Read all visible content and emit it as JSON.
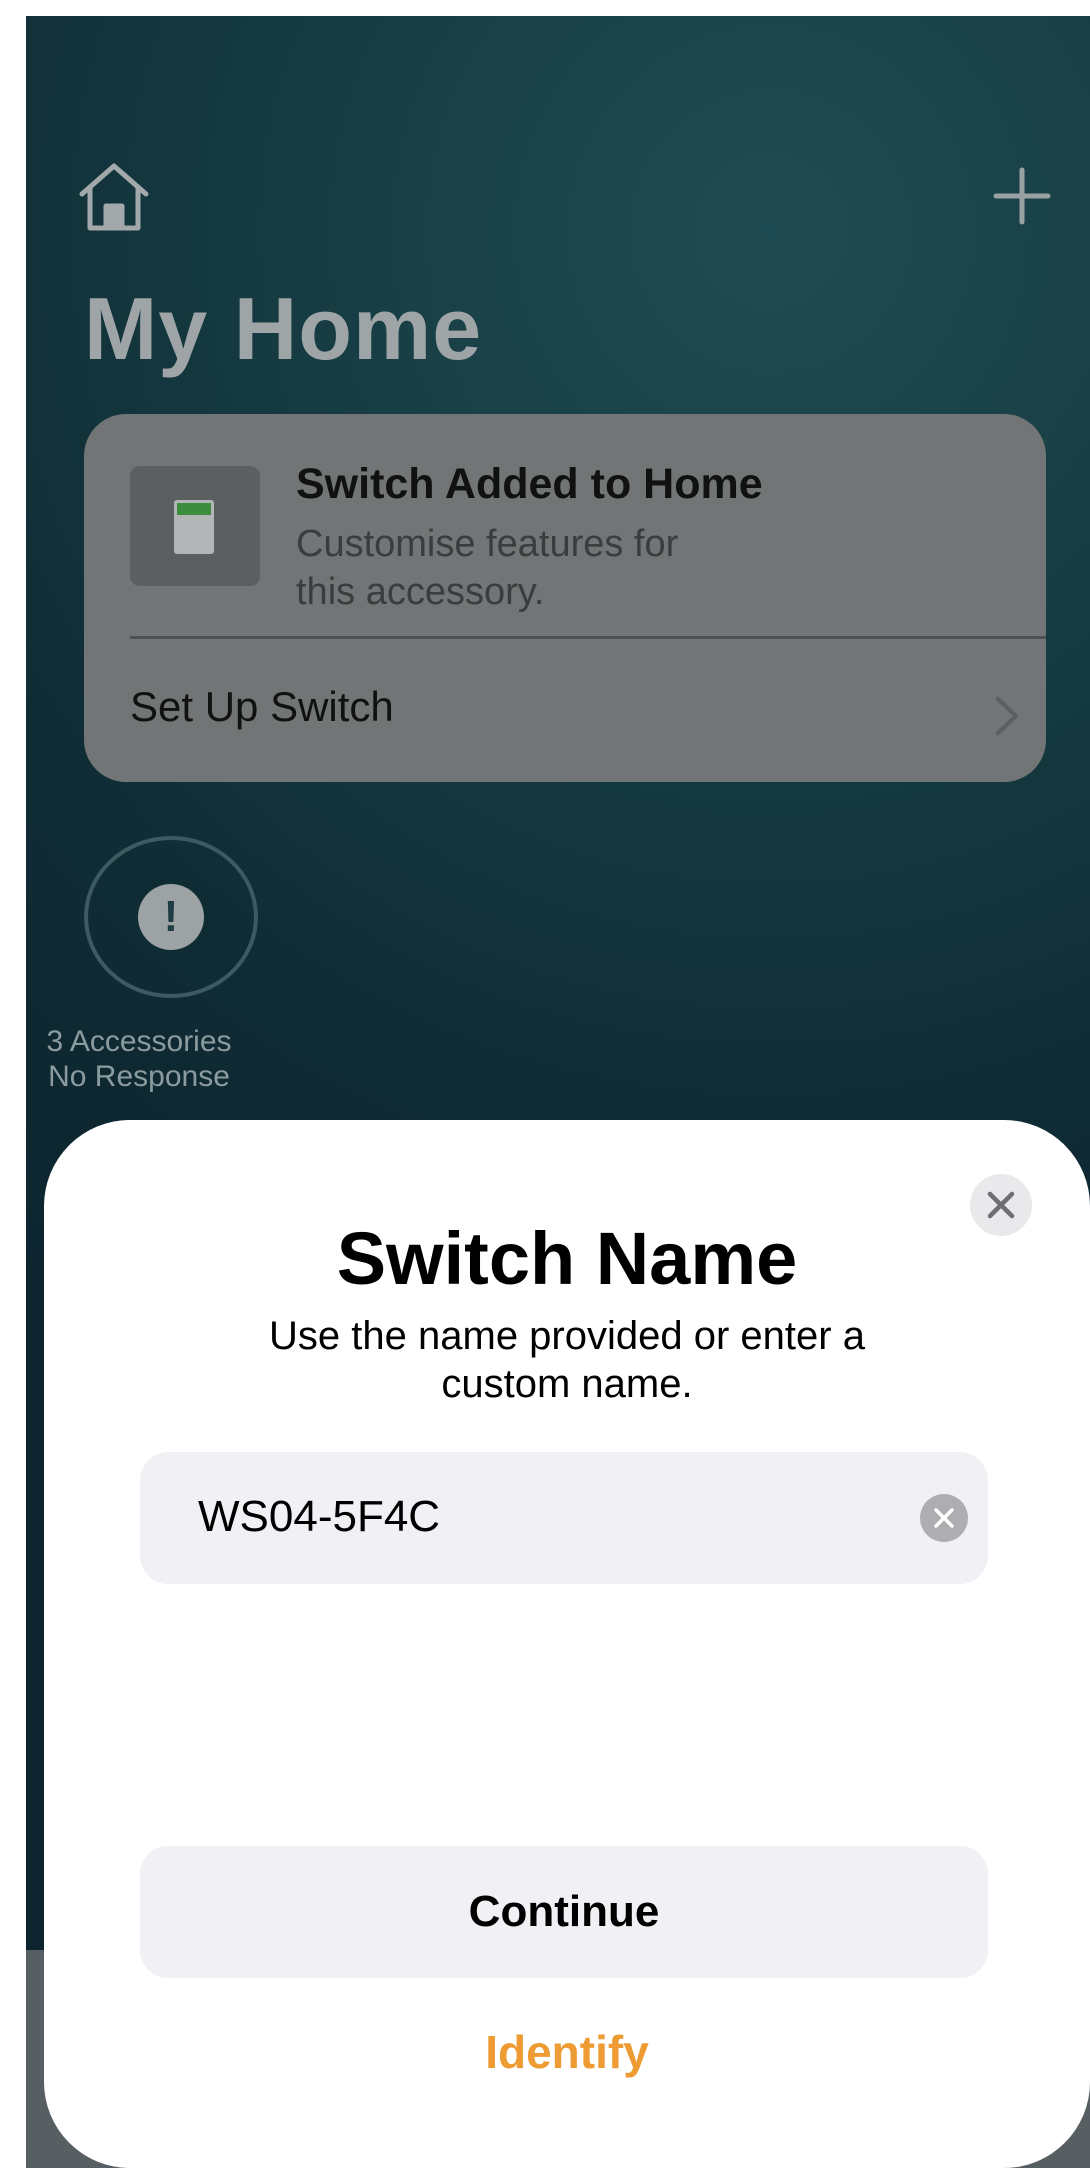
{
  "background": {
    "page_title": "My Home",
    "header_icons": {
      "left": "home-icon",
      "right": "plus-icon"
    },
    "notification_card": {
      "title": "Switch Added to Home",
      "subtitle_line1": "Customise features for",
      "subtitle_line2": "this accessory.",
      "action_label": "Set Up Switch",
      "thumbnail_icon": "switch-icon",
      "chevron_icon": "chevron-right-icon"
    },
    "status": {
      "icon": "exclamation-icon",
      "line1": "3 Accessories",
      "line2": "No Response"
    }
  },
  "sheet": {
    "title": "Switch Name",
    "description": "Use the name provided or enter a custom name.",
    "name_field_value": "WS04-5F4C",
    "continue_label": "Continue",
    "identify_label": "Identify",
    "close_icon": "close-icon",
    "clear_icon": "clear-icon"
  },
  "colors": {
    "accent": "#EE9B33",
    "sheet_background": "#FFFFFF",
    "field_background": "#F0F0F5"
  }
}
